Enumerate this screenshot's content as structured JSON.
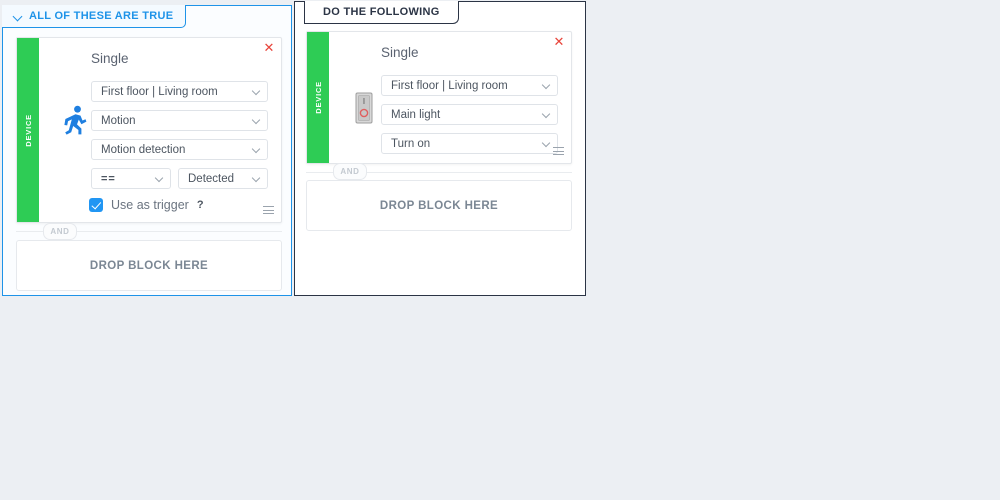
{
  "theme": {
    "accent_blue": "#1e93e8",
    "accent_navy": "#2b3445",
    "device_green": "#2ecc55",
    "checkbox_blue": "#2196f3",
    "close_red": "#e8443a",
    "page_background": "#eceff3"
  },
  "condition_panel": {
    "tab_label": "ALL OF THESE ARE TRUE",
    "tab_icon": "chevron-down-icon",
    "block": {
      "category_label": "DEVICE",
      "title": "Single",
      "icon": "running-person-motion-icon",
      "close_icon": "close-icon",
      "drag_handle_icon": "hamburger-handle-icon",
      "location_select": "First floor | Living room",
      "capability_select": "Motion",
      "attribute_select": "Motion detection",
      "operator_select": "==",
      "value_select": "Detected",
      "trigger_checkbox_label": "Use as trigger",
      "trigger_checkbox_checked": true,
      "help_icon": "?"
    },
    "connector_label": "AND",
    "dropzone_label": "DROP BLOCK HERE"
  },
  "action_panel": {
    "tab_label": "DO THE FOLLOWING",
    "block": {
      "category_label": "DEVICE",
      "title": "Single",
      "icon": "light-switch-icon",
      "close_icon": "close-icon",
      "drag_handle_icon": "hamburger-handle-icon",
      "location_select": "First floor | Living room",
      "device_select": "Main light",
      "command_select": "Turn on"
    },
    "connector_label": "AND",
    "dropzone_label": "DROP BLOCK HERE"
  }
}
